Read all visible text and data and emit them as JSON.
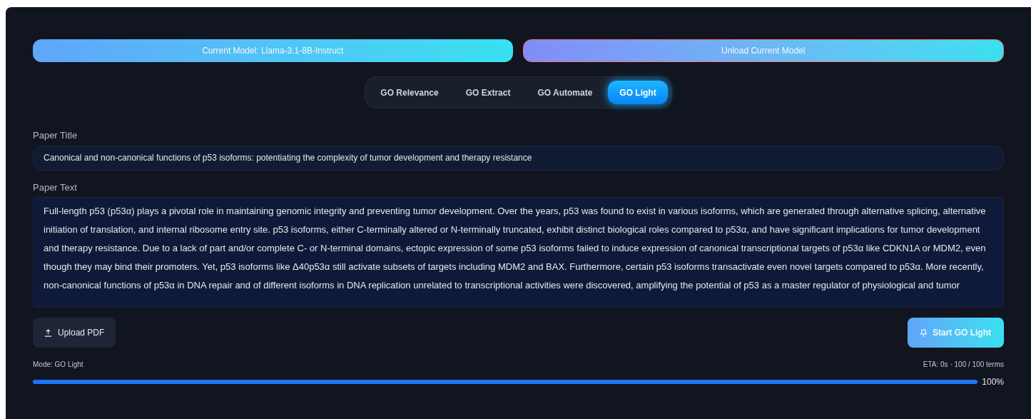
{
  "model_buttons": [
    "Current Model: Llama-3.1-8B-Instruct",
    "Unload Current Model"
  ],
  "tabs": [
    {
      "label": "GO Relevance",
      "selected": false
    },
    {
      "label": "GO Extract",
      "selected": false
    },
    {
      "label": "GO Automate",
      "selected": false
    },
    {
      "label": "GO Light",
      "selected": true
    }
  ],
  "paper_title": {
    "label": "Paper Title",
    "value": "Canonical and non-canonical functions of p53 isoforms: potentiating the complexity of tumor development and therapy resistance"
  },
  "paper_text": {
    "label": "Paper Text",
    "value": "Full-length p53 (p53α) plays a pivotal role in maintaining genomic integrity and preventing tumor development. Over the years, p53 was found to exist in various isoforms, which are generated through alternative splicing, alternative initiation of translation, and internal ribosome entry site. p53 isoforms, either C-terminally altered or N-terminally truncated, exhibit distinct biological roles compared to p53α, and have significant implications for tumor development and therapy resistance. Due to a lack of part and/or complete C- or N-terminal domains, ectopic expression of some p53 isoforms failed to induce expression of canonical transcriptional targets of p53α like CDKN1A or MDM2, even though they may bind their promoters. Yet, p53 isoforms like Δ40p53α still activate subsets of targets including MDM2 and BAX. Furthermore, certain p53 isoforms transactivate even novel targets compared to p53α. More recently, non-canonical functions of p53α in DNA repair and of different isoforms in DNA replication unrelated to transcriptional activities were discovered, amplifying the potential of p53 as a master regulator of physiological and tumor"
  },
  "upload_button": "Upload PDF",
  "start_button": "Start GO Light",
  "mode": "Mode: GO Light",
  "eta": "ETA: 0s · 100 / 100 terms",
  "progress": {
    "level": 1.0,
    "reading": "100%"
  }
}
